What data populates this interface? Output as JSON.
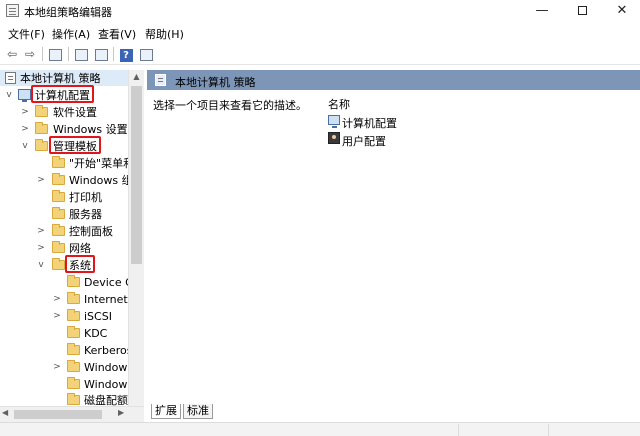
{
  "window": {
    "title": "本地组策略编辑器",
    "minimize_glyph": "—",
    "close_glyph": "✕"
  },
  "menu": [
    {
      "label": "文件(F)"
    },
    {
      "label": "操作(A)"
    },
    {
      "label": "查看(V)"
    },
    {
      "label": "帮助(H)"
    }
  ],
  "toolbar": {
    "back_glyph": "⇦",
    "forward_glyph": "⇨",
    "help_glyph": "?"
  },
  "tree": [
    {
      "label": "本地计算机 策略",
      "icon": "doc-icon",
      "toggle": ""
    },
    {
      "label": "计算机配置",
      "icon": "computer-icon",
      "toggle": "v"
    },
    {
      "label": "软件设置",
      "icon": "folder-icon",
      "toggle": ">"
    },
    {
      "label": "Windows 设置",
      "icon": "folder-icon",
      "toggle": ">"
    },
    {
      "label": "管理模板",
      "icon": "folder-icon",
      "toggle": "v"
    },
    {
      "label": "\"开始\"菜单和任",
      "icon": "folder-icon",
      "toggle": ""
    },
    {
      "label": "Windows 组件",
      "icon": "folder-icon",
      "toggle": ">"
    },
    {
      "label": "打印机",
      "icon": "folder-icon",
      "toggle": ""
    },
    {
      "label": "服务器",
      "icon": "folder-icon",
      "toggle": ""
    },
    {
      "label": "控制面板",
      "icon": "folder-icon",
      "toggle": ">"
    },
    {
      "label": "网络",
      "icon": "folder-icon",
      "toggle": ">"
    },
    {
      "label": "系统",
      "icon": "folder-icon",
      "toggle": "v"
    },
    {
      "label": "Device Gu",
      "icon": "folder-icon",
      "toggle": ""
    },
    {
      "label": "Internet 通",
      "icon": "folder-icon",
      "toggle": ">"
    },
    {
      "label": "iSCSI",
      "icon": "folder-icon",
      "toggle": ">"
    },
    {
      "label": "KDC",
      "icon": "folder-icon",
      "toggle": ""
    },
    {
      "label": "Kerberos",
      "icon": "folder-icon",
      "toggle": ""
    },
    {
      "label": "Windows",
      "icon": "folder-icon",
      "toggle": ">"
    },
    {
      "label": "Windows",
      "icon": "folder-icon",
      "toggle": ""
    },
    {
      "label": "磁盘配额",
      "icon": "folder-icon",
      "toggle": ""
    }
  ],
  "content": {
    "header_title": "本地计算机 策略",
    "description": "选择一个项目来查看它的描述。",
    "column_name": "名称",
    "items": [
      {
        "label": "计算机配置",
        "icon": "computer-icon"
      },
      {
        "label": "用户配置",
        "icon": "user-icon"
      }
    ]
  },
  "tabs": [
    {
      "label": "扩展"
    },
    {
      "label": "标准"
    }
  ],
  "colors": {
    "header_bar": "#7d96b7",
    "highlight_box": "#e0161b",
    "folder": "#f2d37a"
  }
}
